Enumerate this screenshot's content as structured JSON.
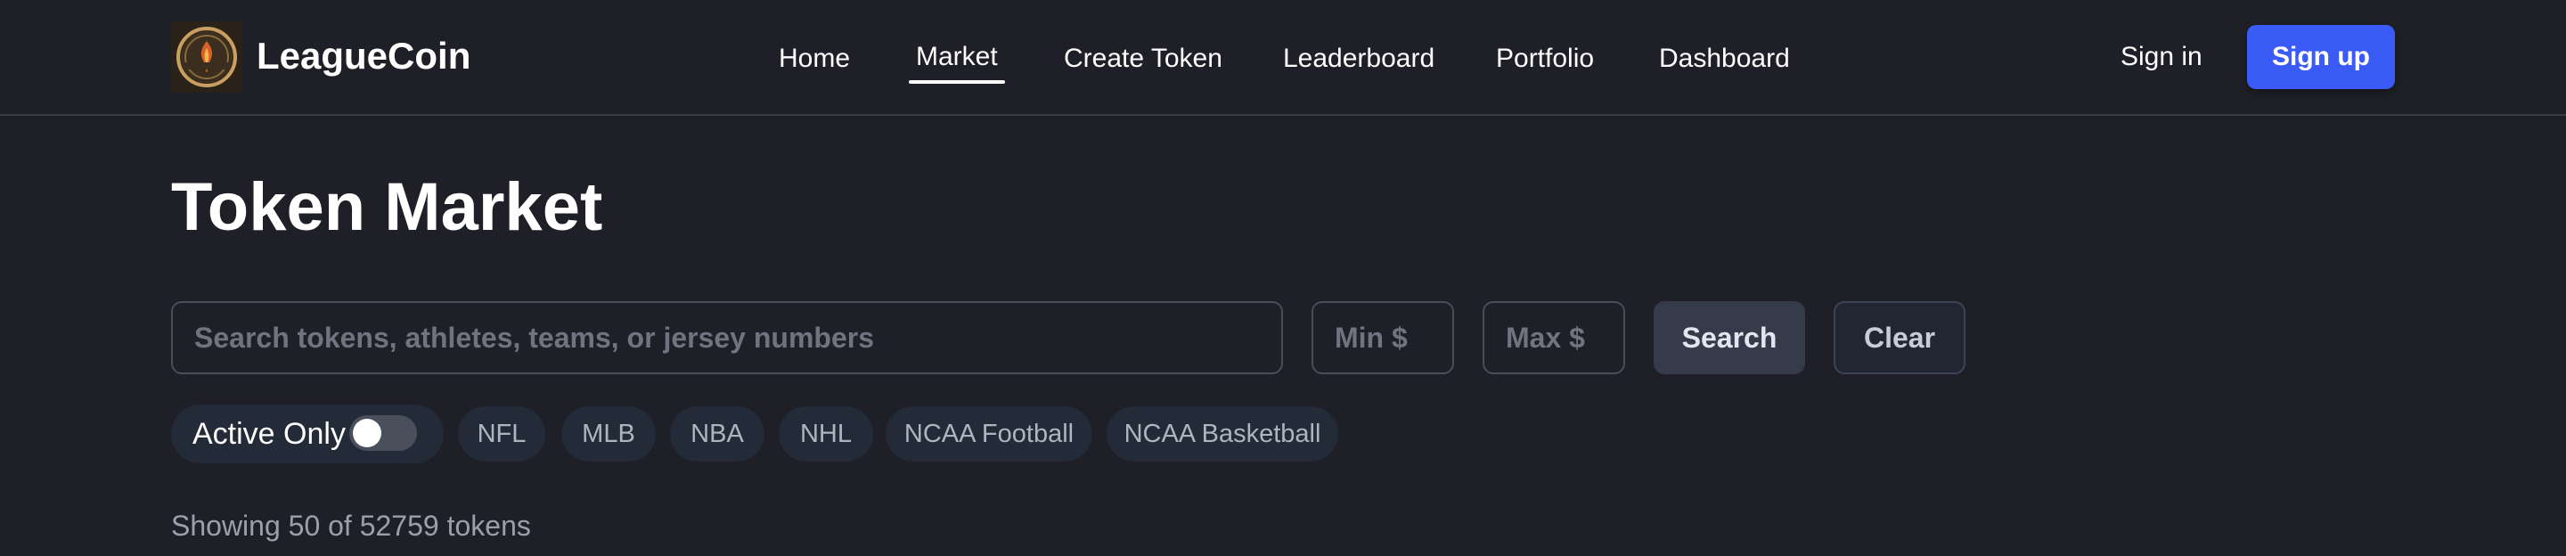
{
  "brand": {
    "name": "LeagueCoin",
    "logo_icon": "coin-emblem-icon",
    "colors": {
      "accent": "#3a5bf5",
      "background": "#1f1f27",
      "chip": "#232a38"
    }
  },
  "nav": {
    "items": [
      {
        "label": "Home",
        "active": false
      },
      {
        "label": "Market",
        "active": true
      },
      {
        "label": "Create Token",
        "active": false
      },
      {
        "label": "Leaderboard",
        "active": false
      },
      {
        "label": "Portfolio",
        "active": false
      },
      {
        "label": "Dashboard",
        "active": false
      }
    ]
  },
  "auth": {
    "signin_label": "Sign in",
    "signup_label": "Sign up"
  },
  "page": {
    "title": "Token Market"
  },
  "search": {
    "query_value": "",
    "query_placeholder": "Search tokens, athletes, teams, or jersey numbers",
    "min_value": "",
    "min_placeholder": "Min $",
    "max_value": "",
    "max_placeholder": "Max $",
    "search_label": "Search",
    "clear_label": "Clear"
  },
  "filters": {
    "active_only_label": "Active Only",
    "active_only_on": false,
    "leagues": [
      "NFL",
      "MLB",
      "NBA",
      "NHL",
      "NCAA Football",
      "NCAA Basketball"
    ]
  },
  "results": {
    "summary": "Showing 50 of 52759 tokens"
  }
}
